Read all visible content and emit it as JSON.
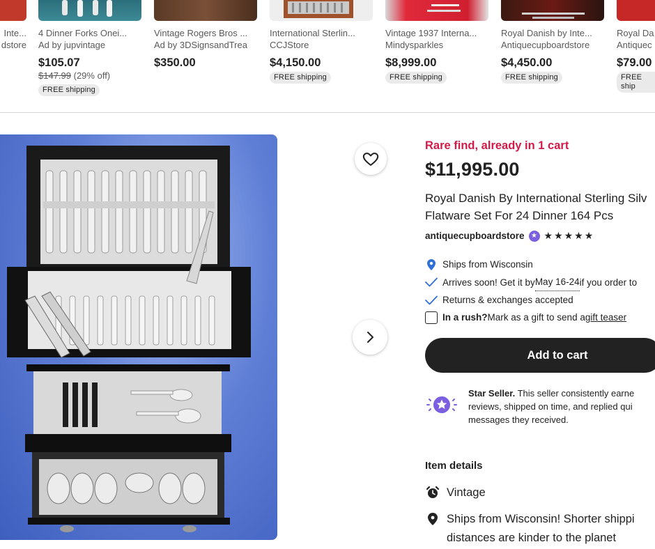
{
  "recommendations": [
    {
      "title": "Inte...",
      "shop": "dstore",
      "price": "",
      "shipping": ""
    },
    {
      "title": "4 Dinner Forks Onei...",
      "shop": "Ad by jupvintage",
      "price": "$105.07",
      "original_price": "$147.99",
      "discount": "(29% off)",
      "shipping": "FREE shipping"
    },
    {
      "title": "Vintage Rogers Bros ...",
      "shop": "Ad by 3DSignsandTrea",
      "price": "$350.00",
      "shipping": ""
    },
    {
      "title": "International Sterlin...",
      "shop": "CCJStore",
      "price": "$4,150.00",
      "shipping": "FREE shipping"
    },
    {
      "title": "Vintage 1937 Interna...",
      "shop": "Mindysparkles",
      "price": "$8,999.00",
      "shipping": "FREE shipping"
    },
    {
      "title": "Royal Danish by Inte...",
      "shop": "Antiquecupboardstore",
      "price": "$4,450.00",
      "shipping": "FREE shipping"
    },
    {
      "title": "Royal Da",
      "shop": "Antiquec",
      "price": "$79.00",
      "shipping": "FREE ship"
    }
  ],
  "icons": {
    "favorite": "heart-icon",
    "next": "chevron-right-icon",
    "location": "map-pin-icon",
    "check": "checkmark-icon",
    "star_seller": "star-seller-badge-icon",
    "vintage": "alarm-clock-icon"
  },
  "colors": {
    "rare": "#d21b48",
    "cart_button": "#222222",
    "star_badge": "#7b5fe0",
    "location_pin": "#2f6fd8",
    "check": "#2f6fd8"
  },
  "listing": {
    "rare_find": "Rare find, already in 1 cart",
    "price": "$11,995.00",
    "title_line1": "Royal Danish By International Sterling Silv",
    "title_line2": "Flatware Set For 24 Dinner 164 Pcs",
    "shop_name": "antiquecupboardstore",
    "rating_stars": "★★★★★",
    "ships_from": "Ships from Wisconsin",
    "arrives_prefix": "Arrives soon! Get it by ",
    "arrives_date": "May 16-24",
    "arrives_suffix": " if you order to",
    "returns": "Returns & exchanges accepted",
    "rush_bold": "In a rush?",
    "rush_text": " Mark as a gift to send a ",
    "rush_link": "gift teaser",
    "add_to_cart": "Add to cart",
    "star_seller_bold": "Star Seller.",
    "star_seller_text": " This seller consistently earned reviews, shipped on time, and replied qui messages they received.",
    "star_seller_line1_rest": " This seller consistently earne",
    "star_seller_line2": "reviews, shipped on time, and replied qui",
    "star_seller_line3": "messages they received.",
    "item_details_heading": "Item details",
    "detail_vintage": "Vintage",
    "detail_ships_line1": "Ships from Wisconsin! Shorter shippi",
    "detail_ships_line2": "distances are kinder to the planet"
  }
}
